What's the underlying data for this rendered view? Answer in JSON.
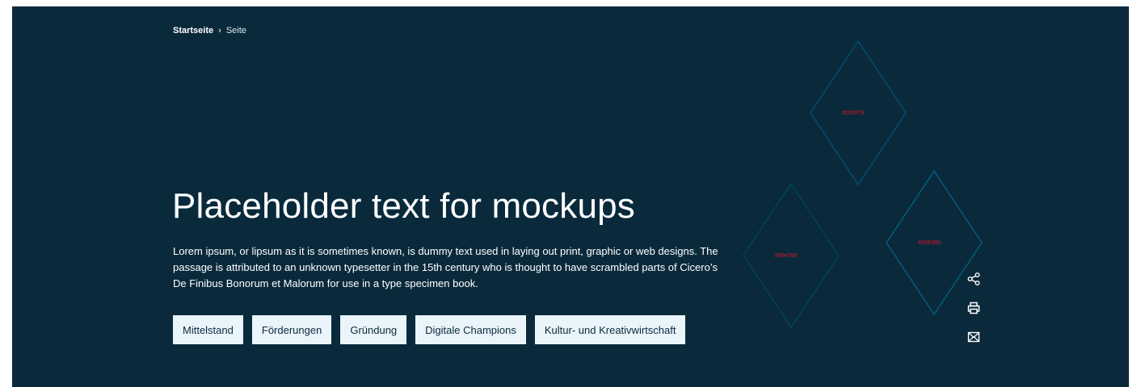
{
  "breadcrumb": {
    "home": "Startseite",
    "separator": "›",
    "current": "Seite"
  },
  "hero": {
    "title": "Placeholder text for mockups",
    "lead": "Lorem ipsum, or lipsum as it is sometimes known, is dummy text used in laying out print, graphic or web designs. The passage is attributed to an unknown typesetter in the 15th century who is thought to have scrambled parts of Cicero’s De Finibus Bonorum et Malorum for use in a type specimen book.",
    "tags": [
      "Mittelstand",
      "Förderungen",
      "Gründung",
      "Digitale Champions",
      "Kultur- und Kreativwirtschaft"
    ]
  },
  "decor": {
    "diamonds": [
      {
        "label": "#005579",
        "color": "#005579"
      },
      {
        "label": "#004765",
        "color": "#004765"
      },
      {
        "label": "#00638D",
        "color": "#00638D"
      }
    ],
    "label_color": "#e0112b"
  },
  "actions": [
    {
      "icon": "share-icon"
    },
    {
      "icon": "print-icon"
    },
    {
      "icon": "mail-icon"
    }
  ],
  "colors": {
    "background": "#0a2a3b",
    "tag_background": "#eaf4fb",
    "text": "#ffffff"
  }
}
